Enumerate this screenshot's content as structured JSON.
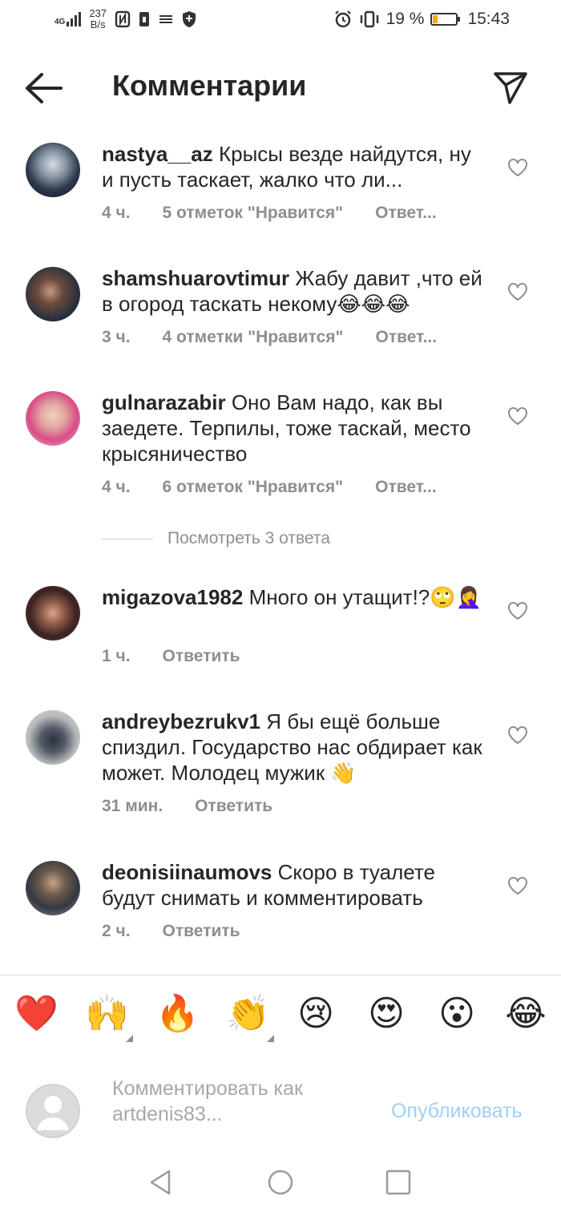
{
  "status_bar": {
    "network": "4G",
    "speed_value": "237",
    "speed_unit": "B/s",
    "battery_percent": "19 %",
    "battery_level": 0.19,
    "time": "15:43"
  },
  "header": {
    "title": "Комментарии"
  },
  "comments": [
    {
      "username": "nastya__az",
      "text": "Крысы везде найдутся, ну и пусть таскает, жалко что ли...",
      "time": "4 ч.",
      "likes": "5 отметок \"Нравится\"",
      "reply": "Ответ..."
    },
    {
      "username": "shamshuarovtimur",
      "text": "Жабу давит ,что ей в огород таскать некому😂😂😂",
      "time": "3 ч.",
      "likes": "4 отметки \"Нравится\"",
      "reply": "Ответ..."
    },
    {
      "username": "gulnarazabir",
      "text": "Оно Вам надо, как вы заедете. Терпилы, тоже таскай, место крысяничество",
      "time": "4 ч.",
      "likes": "6 отметок \"Нравится\"",
      "reply": "Ответ..."
    },
    {
      "username": "migazova1982",
      "text": "Много он утащит!?🙄🤦‍♀️",
      "time": "1 ч.",
      "likes": "",
      "reply": "Ответить"
    },
    {
      "username": "andreybezrukv1",
      "text": "Я бы ещё больше спиздил. Государство нас обдирает как может. Молодец мужик 👋",
      "time": "31 мин.",
      "likes": "",
      "reply": "Ответить"
    },
    {
      "username": "deonisiinaumovs",
      "text": "Скоро в туалете будут снимать и комментировать",
      "time": "2 ч.",
      "likes": "",
      "reply": "Ответить"
    }
  ],
  "view_replies": "Посмотреть 3 ответа",
  "emoji_bar": [
    "❤️",
    "🙌",
    "🔥",
    "👏",
    "😢",
    "😍",
    "😮",
    "😂"
  ],
  "input": {
    "placeholder": "Комментировать как artdenis83...",
    "publish_label": "Опубликовать"
  },
  "colors": {
    "text": "#262626",
    "meta": "#8e8e8e",
    "publish_disabled": "#9fd1f6",
    "battery_low": "#f5a623"
  }
}
